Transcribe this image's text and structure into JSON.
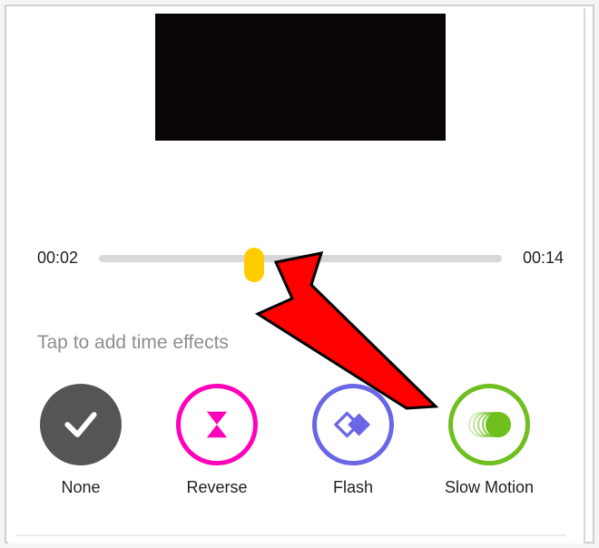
{
  "timeline": {
    "start_label": "00:02",
    "end_label": "00:14"
  },
  "hint_text": "Tap to add time effects",
  "effects": {
    "none": {
      "label": "None",
      "icon": "check-icon"
    },
    "reverse": {
      "label": "Reverse",
      "icon": "hourglass-icon"
    },
    "flash": {
      "label": "Flash",
      "icon": "diamond-overlap-icon"
    },
    "slow_motion": {
      "label": "Slow Motion",
      "icon": "motion-circles-icon"
    }
  },
  "colors": {
    "none_bg": "#565555",
    "reverse_ring": "#ff00bb",
    "flash_ring": "#6b66e6",
    "slomo_ring": "#6fbf1f",
    "handle": "#ffcc00",
    "arrow": "#ff0000"
  }
}
